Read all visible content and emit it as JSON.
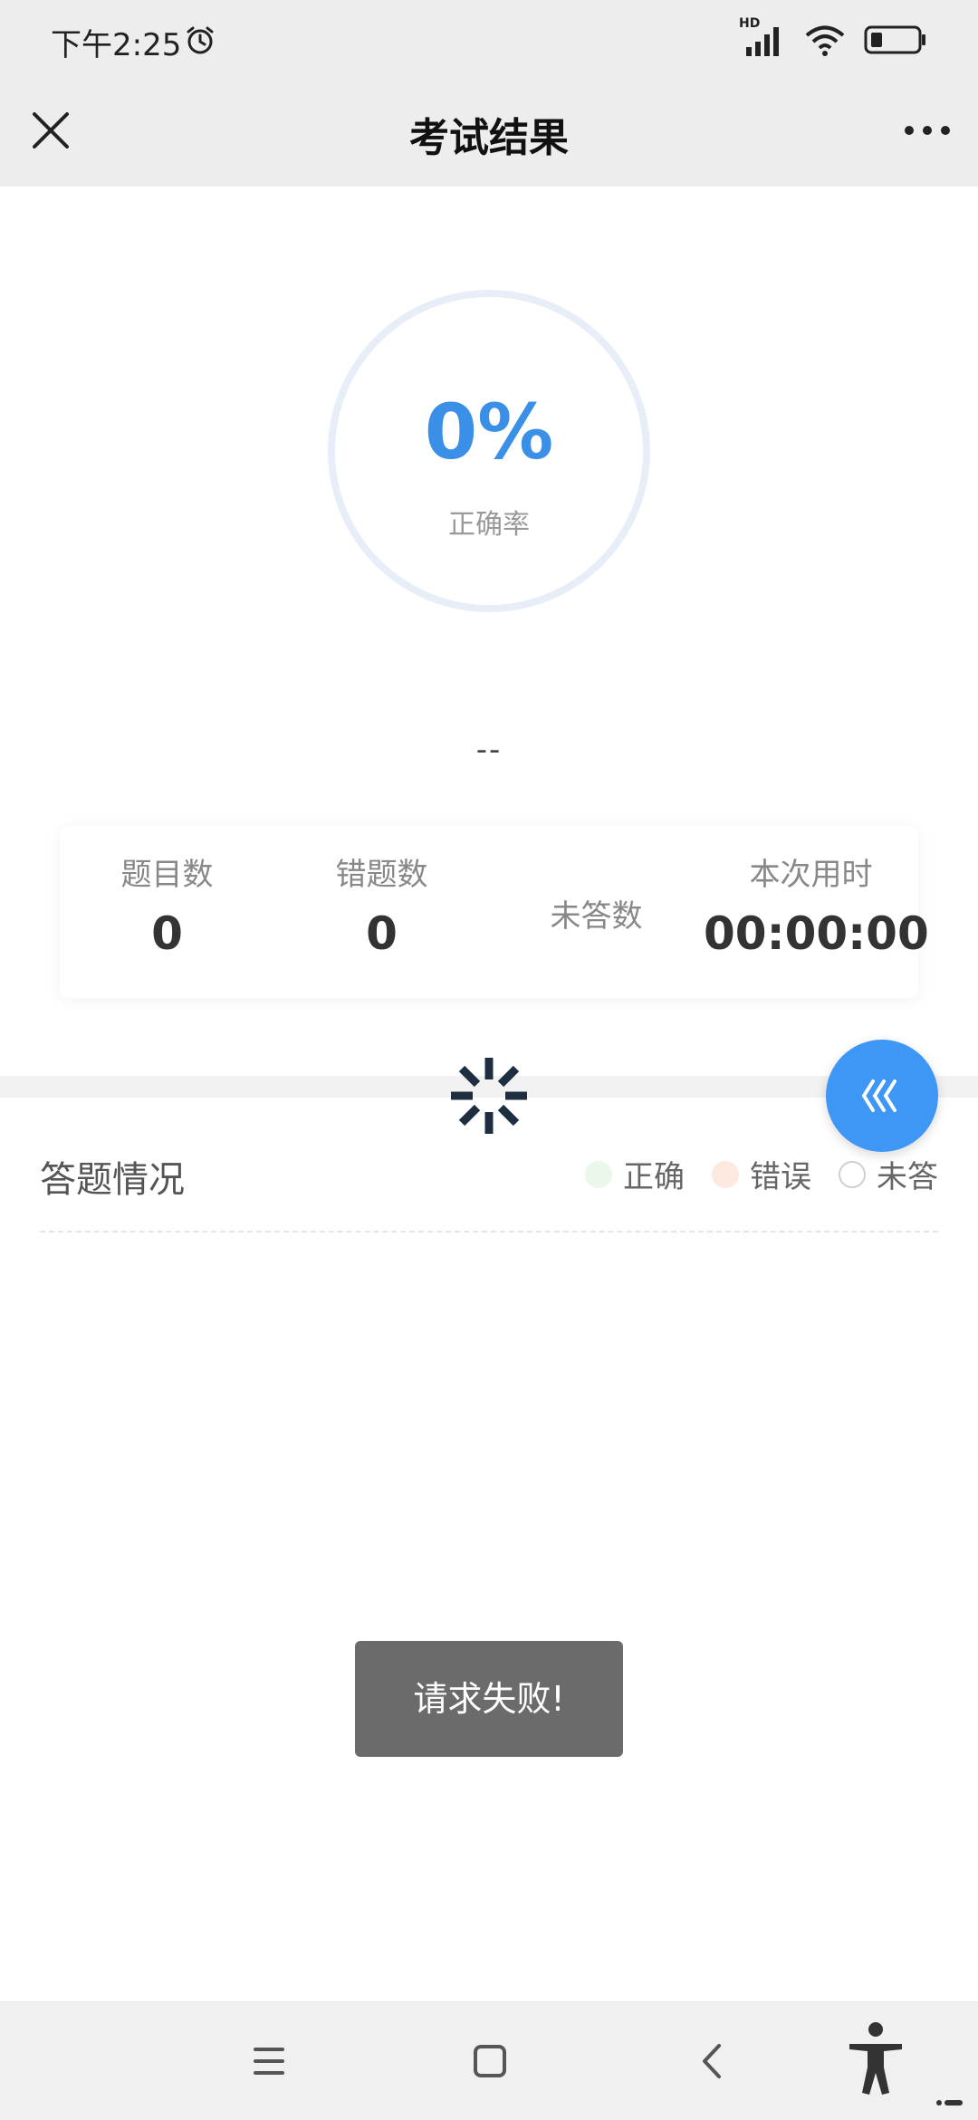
{
  "status_bar": {
    "time": "下午2:25",
    "network": "HD"
  },
  "header": {
    "title": "考试结果"
  },
  "result": {
    "accuracy_value": "0%",
    "accuracy_label": "正确率",
    "summary": "--"
  },
  "stats": [
    {
      "label": "题目数",
      "value": "0"
    },
    {
      "label": "错题数",
      "value": "0"
    },
    {
      "label": "未答数",
      "value": ""
    },
    {
      "label": "本次用时",
      "value": "00:00:00"
    }
  ],
  "answers": {
    "title": "答题情况",
    "legend": [
      {
        "label": "正确",
        "color": "#e9f8ea"
      },
      {
        "label": "错误",
        "color": "#fde9de"
      },
      {
        "label": "未答",
        "color": "#ffffff"
      }
    ]
  },
  "toast": {
    "message": "请求失败!"
  },
  "colors": {
    "accent": "#3e96f5",
    "accuracy": "#3a8fe6",
    "toast_bg": "#6b6b6b",
    "bar_bg": "#ededed"
  },
  "icons": {
    "close": "close-icon",
    "more": "more-icon",
    "float": "collapse-icon",
    "alarm": "alarm-icon",
    "signal": "signal-icon",
    "wifi": "wifi-icon",
    "battery": "battery-icon",
    "nav_menu": "menu-icon",
    "nav_home": "home-icon",
    "nav_back": "back-icon",
    "nav_accessibility": "accessibility-icon",
    "spinner": "loading-spinner-icon"
  }
}
